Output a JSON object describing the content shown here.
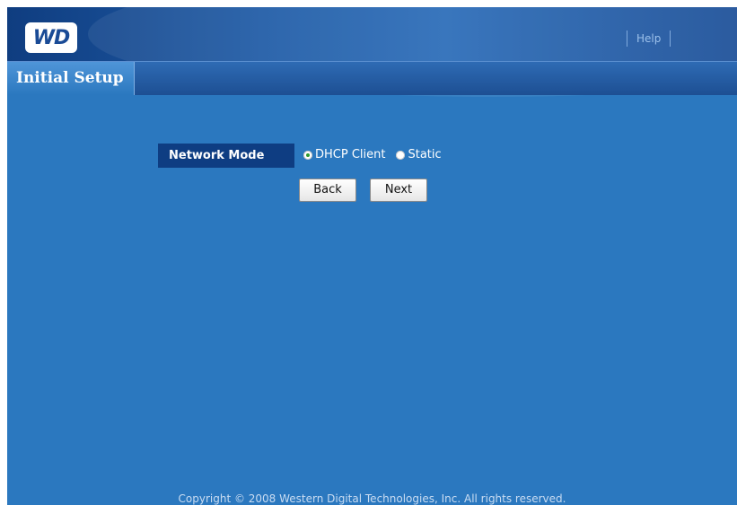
{
  "header": {
    "logo_text": "WD",
    "help_label": "Help"
  },
  "tabs": [
    {
      "label": "Initial Setup",
      "active": true
    }
  ],
  "form": {
    "network_mode_label": "Network Mode",
    "options": [
      {
        "label": "DHCP Client",
        "checked": true
      },
      {
        "label": "Static",
        "checked": false
      }
    ],
    "back_label": "Back",
    "next_label": "Next"
  },
  "footer": {
    "copyright": "Copyright © 2008 Western Digital Technologies, Inc. All rights reserved."
  },
  "colors": {
    "page_background": "#2b78bf",
    "header_dark": "#0f3d80",
    "label_background": "#0e3d82"
  }
}
